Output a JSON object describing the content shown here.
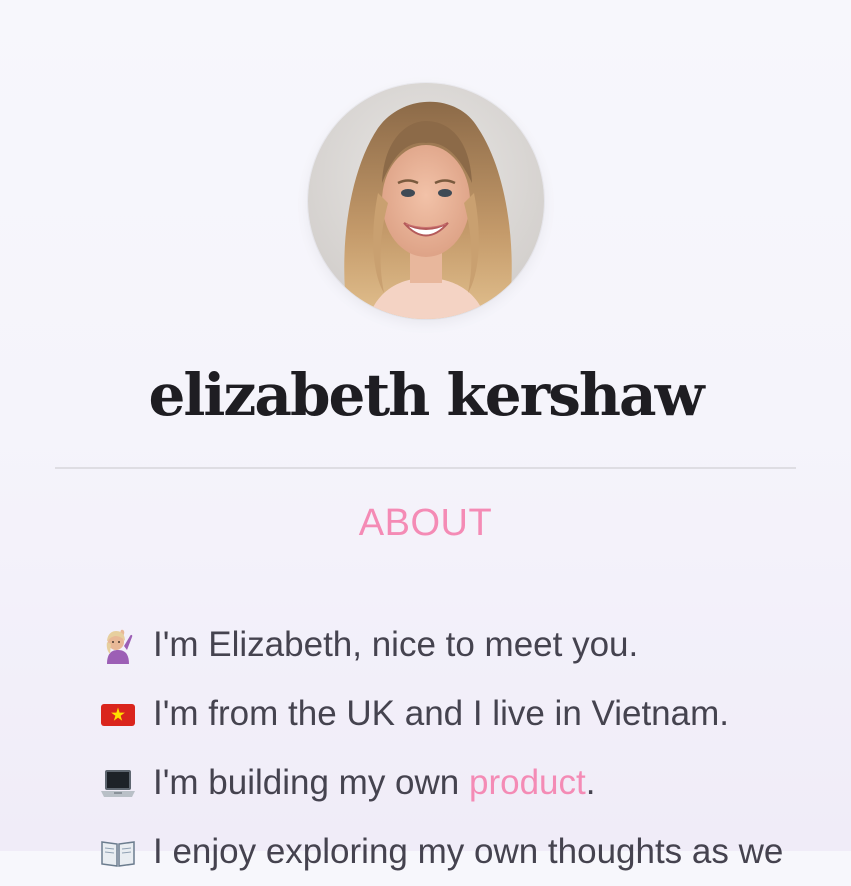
{
  "profile": {
    "name": "elizabeth kershaw"
  },
  "about": {
    "heading": "ABOUT",
    "items": [
      {
        "emoji": "person-raising-hand-icon",
        "text": "I'm Elizabeth, nice to meet you."
      },
      {
        "emoji": "vietnam-flag-icon",
        "text": "I'm from the UK and I live in Vietnam."
      },
      {
        "emoji": "laptop-icon",
        "text_before": "I'm building my own ",
        "link": "product",
        "text_after": "."
      },
      {
        "emoji": "open-book-icon",
        "text": "I enjoy exploring my own thoughts as we"
      }
    ]
  },
  "colors": {
    "accent": "#f48bb5",
    "text": "#45434f",
    "heading": "#1e1d22",
    "divider": "#dedde3"
  }
}
